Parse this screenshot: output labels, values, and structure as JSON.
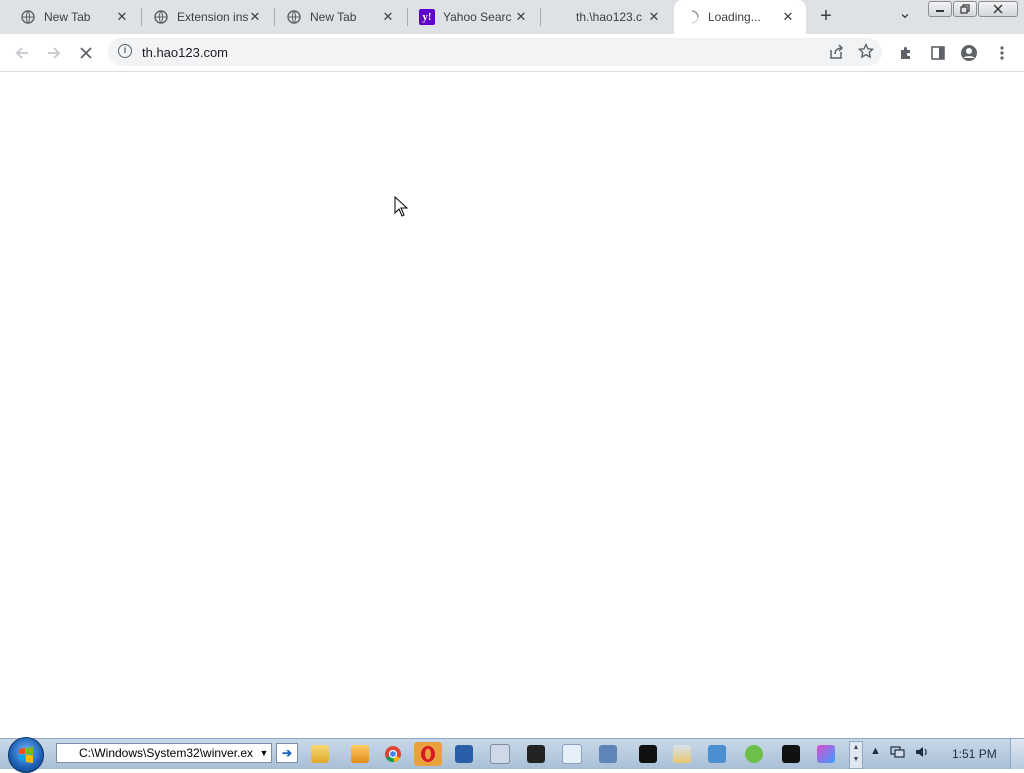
{
  "tabs": [
    {
      "title": "New Tab",
      "icon": "globe-icon"
    },
    {
      "title": "Extension ins",
      "icon": "globe-icon"
    },
    {
      "title": "New Tab",
      "icon": "globe-icon"
    },
    {
      "title": "Yahoo Searc",
      "icon": "yahoo-icon"
    },
    {
      "title": "th.\\hao123.c",
      "icon": "none"
    },
    {
      "title": "Loading...",
      "icon": "spinner-icon"
    }
  ],
  "tab_close_glyph": "✕",
  "new_tab_glyph": "+",
  "tab_search_glyph": "⌄",
  "omnibox": {
    "url": "th.hao123.com",
    "info_glyph": "i"
  },
  "taskbar": {
    "address_value": "C:\\Windows\\System32\\winver.ex",
    "go_glyph": "➔",
    "clock": "1:51 PM"
  },
  "colors": {
    "tab_strip": "#dee1e6",
    "active_tab": "#ffffff",
    "taskbar": "#b9cce0",
    "yahoo": "#6001d2",
    "opera": "#d9172a"
  }
}
